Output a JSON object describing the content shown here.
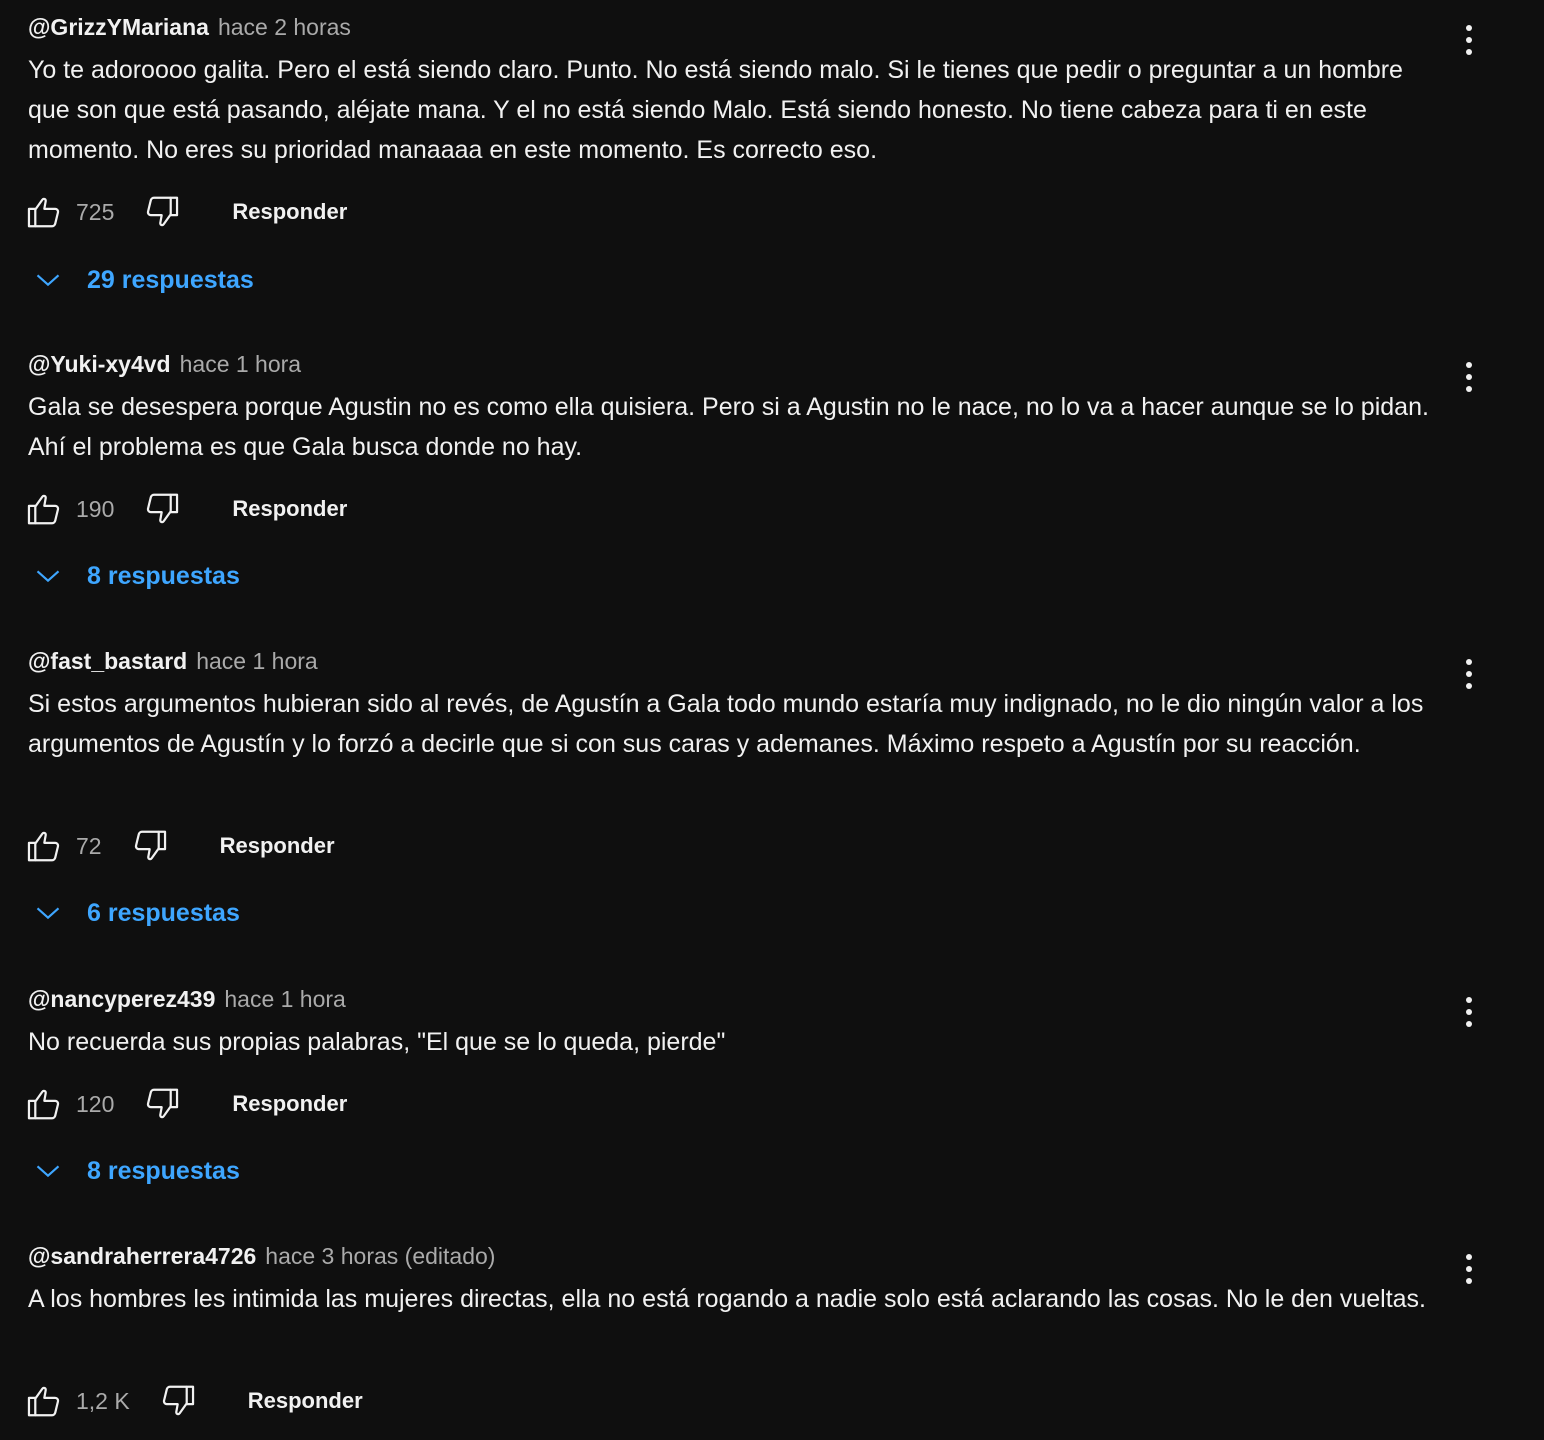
{
  "colors": {
    "background": "#0f0f0f",
    "text": "#f1f1f1",
    "muted": "#aaaaaa",
    "link": "#3ea6ff"
  },
  "icons": {
    "like": "thumbs-up-icon",
    "dislike": "thumbs-down-icon",
    "menu": "more-vert-icon",
    "expand": "chevron-down-icon"
  },
  "comments": [
    {
      "author": "@GrizzYMariana",
      "time": "hace 2 horas",
      "text": "Yo te adoroooo galita. Pero el está siendo claro. Punto. No está siendo malo. Si le tienes que pedir o preguntar a un hombre que son que está pasando, aléjate mana. Y el no está siendo Malo. Está siendo honesto. No tiene cabeza para ti en este momento. No eres su prioridad manaaaa en este momento. Es correcto eso.",
      "likes": "725",
      "reply_label": "Responder",
      "replies_label": "29 respuestas"
    },
    {
      "author": "@Yuki-xy4vd",
      "time": "hace 1 hora",
      "text": "Gala se desespera porque Agustin no es como ella quisiera. Pero si a Agustin no le nace, no lo va a hacer aunque se lo pidan. Ahí el problema es que Gala busca donde no hay.",
      "likes": "190",
      "reply_label": "Responder",
      "replies_label": "8 respuestas"
    },
    {
      "author": "@fast_bastard",
      "time": "hace 1 hora",
      "text": "Si estos argumentos hubieran sido al revés, de Agustín a Gala todo mundo estaría muy indignado, no le dio ningún valor a los argumentos de Agustín y lo forzó a decirle que si con sus caras y ademanes. Máximo respeto a Agustín por su reacción.",
      "likes": "72",
      "reply_label": "Responder",
      "replies_label": "6 respuestas"
    },
    {
      "author": "@nancyperez439",
      "time": "hace 1 hora",
      "text": "No recuerda sus propias palabras, \"El que se lo queda, pierde\"",
      "likes": "120",
      "reply_label": "Responder",
      "replies_label": "8 respuestas"
    },
    {
      "author": "@sandraherrera4726",
      "time": "hace 3 horas (editado)",
      "text": "A los hombres les intimida las mujeres directas, ella no está rogando a nadie solo está aclarando las cosas. No le den vueltas.",
      "likes": "1,2 K",
      "reply_label": "Responder"
    }
  ]
}
